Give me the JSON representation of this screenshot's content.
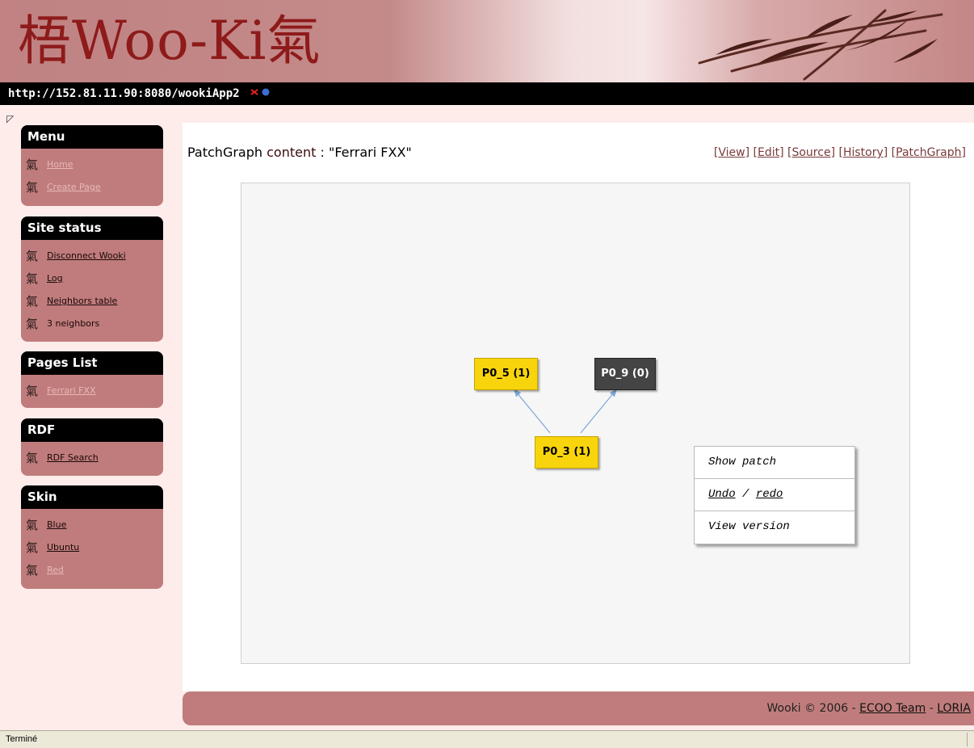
{
  "header": {
    "logo_text": "梧Woo-Ki氣",
    "url": "http://152.81.11.90:8080/wookiApp2"
  },
  "sidebar": {
    "boxes": [
      {
        "title": "Menu",
        "items": [
          {
            "label": "Home",
            "dim": true
          },
          {
            "label": "Create Page",
            "dim": true
          }
        ]
      },
      {
        "title": "Site status",
        "items": [
          {
            "label": "Disconnect Wooki"
          },
          {
            "label": "Log"
          },
          {
            "label": "Neighbors table"
          },
          {
            "label": "3 neighbors",
            "static": true
          }
        ]
      },
      {
        "title": "Pages List",
        "items": [
          {
            "label": "Ferrari FXX",
            "dim": true
          }
        ]
      },
      {
        "title": "RDF",
        "items": [
          {
            "label": "RDF Search"
          }
        ]
      },
      {
        "title": "Skin",
        "items": [
          {
            "label": "Blue"
          },
          {
            "label": "Ubuntu"
          },
          {
            "label": "Red",
            "dim": true
          }
        ]
      }
    ]
  },
  "content": {
    "title_prefix": "PatchGraph",
    "title_mid": "content :",
    "title_page": "\"Ferrari FXX\"",
    "links": [
      "View",
      "Edit",
      "Source",
      "History",
      "PatchGraph"
    ]
  },
  "graph": {
    "nodes": [
      {
        "id": "P0_5",
        "label": "P0_5 (1)",
        "color": "#f8d40c"
      },
      {
        "id": "P0_9",
        "label": "P0_9 (0)",
        "color": "#444444"
      },
      {
        "id": "P0_3",
        "label": "P0_3 (1)",
        "color": "#f8d40c"
      }
    ],
    "edges": [
      {
        "from": "P0_3",
        "to": "P0_5"
      },
      {
        "from": "P0_3",
        "to": "P0_9"
      }
    ],
    "edge_color": "#7fa6d6",
    "context_menu": {
      "show_patch": "Show patch",
      "undo": "Undo",
      "separator": "/",
      "redo": "redo",
      "view_version": "View version"
    }
  },
  "footer": {
    "prefix": "Wooki © 2006 -",
    "team": "ECOO Team",
    "dash": "-",
    "lab": "LORIA"
  },
  "statusbar": {
    "text": "Terminé"
  },
  "colors": {
    "accent": "#c07c7c",
    "dark_header": "#000000",
    "page_bg": "#fdecea"
  }
}
